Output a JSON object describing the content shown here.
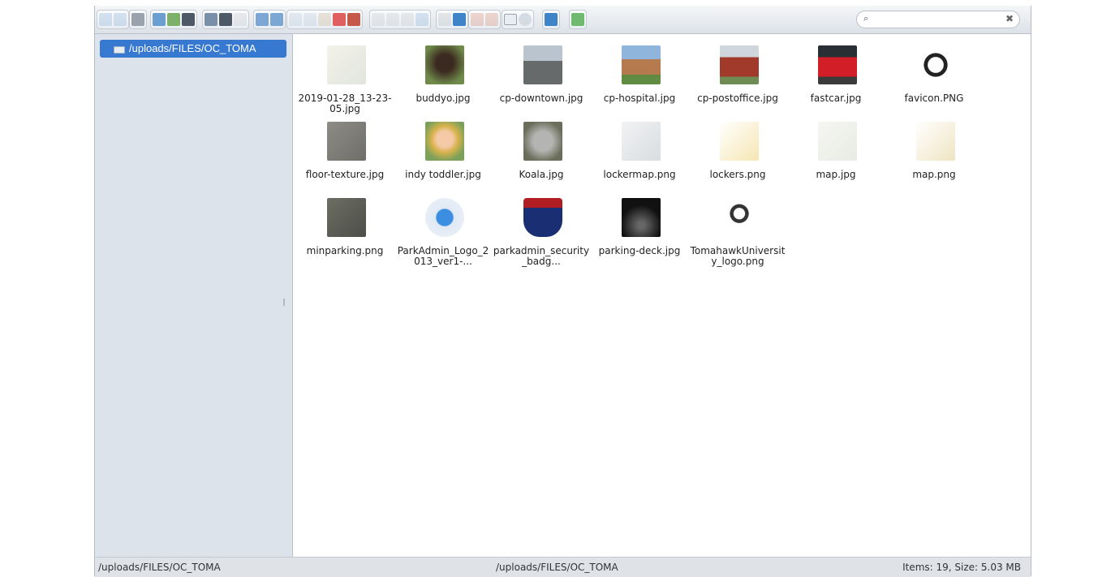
{
  "toolbar": {
    "groups": [
      {
        "buttons": [
          "back-icon",
          "forward-icon"
        ]
      },
      {
        "buttons": [
          "reload-icon"
        ]
      },
      {
        "buttons": [
          "open-icon",
          "upload-icon",
          "save-icon"
        ]
      },
      {
        "buttons": [
          "mkdir-icon",
          "mkfile-icon",
          "new-document-icon"
        ]
      },
      {
        "buttons": [
          "undo-icon",
          "redo-icon"
        ]
      },
      {
        "buttons": [
          "copy-icon",
          "cut-icon",
          "paste-icon",
          "delete-icon",
          "empty-icon"
        ]
      },
      {
        "buttons": [
          "duplicate-icon",
          "rename-icon",
          "edit-icon",
          "resize-icon"
        ]
      },
      {
        "buttons": [
          "preview-icon",
          "info-icon"
        ]
      },
      {
        "buttons": [
          "extract-icon",
          "archive-icon"
        ]
      },
      {
        "buttons": [
          "view-icon",
          "sort-icon"
        ]
      },
      {
        "buttons": [
          "help-icon"
        ]
      },
      {
        "buttons": [
          "fullscreen-icon"
        ]
      }
    ],
    "search_value": ""
  },
  "sidebar": {
    "tree_item": "/uploads/FILES/OC_TOMA"
  },
  "files": [
    {
      "name": "2019-01-28_13-23-05.jpg",
      "thumb": "map"
    },
    {
      "name": "buddyo.jpg",
      "thumb": "dog"
    },
    {
      "name": "cp-downtown.jpg",
      "thumb": "street"
    },
    {
      "name": "cp-hospital.jpg",
      "thumb": "building"
    },
    {
      "name": "cp-postoffice.jpg",
      "thumb": "brick"
    },
    {
      "name": "fastcar.jpg",
      "thumb": "car"
    },
    {
      "name": "favicon.PNG",
      "thumb": "logo"
    },
    {
      "name": "floor-texture.jpg",
      "thumb": "floor"
    },
    {
      "name": "indy toddler.jpg",
      "thumb": "child"
    },
    {
      "name": "Koala.jpg",
      "thumb": "koala"
    },
    {
      "name": "lockermap.png",
      "thumb": "lockermap"
    },
    {
      "name": "lockers.png",
      "thumb": "lockers"
    },
    {
      "name": "map.jpg",
      "thumb": "map2"
    },
    {
      "name": "map.png",
      "thumb": "map3"
    },
    {
      "name": "minparking.png",
      "thumb": "aerial"
    },
    {
      "name": "ParkAdmin_Logo_2013_ver1-...",
      "thumb": "parkadmin"
    },
    {
      "name": "parkadmin_security_badg...",
      "thumb": "badge"
    },
    {
      "name": "parking-deck.jpg",
      "thumb": "deck"
    },
    {
      "name": "TomahawkUniversity_logo.png",
      "thumb": "tomahawk"
    }
  ],
  "statusbar": {
    "left_path": "/uploads/FILES/OC_TOMA",
    "center_path": "/uploads/FILES/OC_TOMA",
    "summary": "Items: 19, Size: 5.03 MB"
  }
}
